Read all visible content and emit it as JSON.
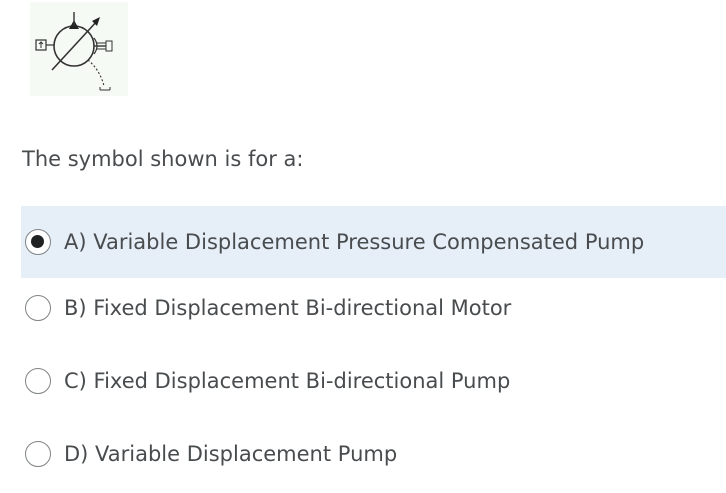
{
  "figure": {
    "icon": "variable-displacement-pressure-compensated-pump-symbol"
  },
  "question": {
    "text": "The symbol shown is for a:"
  },
  "options": [
    {
      "label": "A) Variable Displacement Pressure Compensated Pump",
      "selected": true
    },
    {
      "label": "B) Fixed Displacement Bi-directional Motor",
      "selected": false
    },
    {
      "label": "C) Fixed Displacement Bi-directional Pump",
      "selected": false
    },
    {
      "label": "D) Variable Displacement Pump",
      "selected": false
    }
  ],
  "colors": {
    "selected_background": "#e6eef8",
    "text": "#494c4e",
    "radio_border": "#7f8386",
    "radio_dot": "#202122"
  }
}
